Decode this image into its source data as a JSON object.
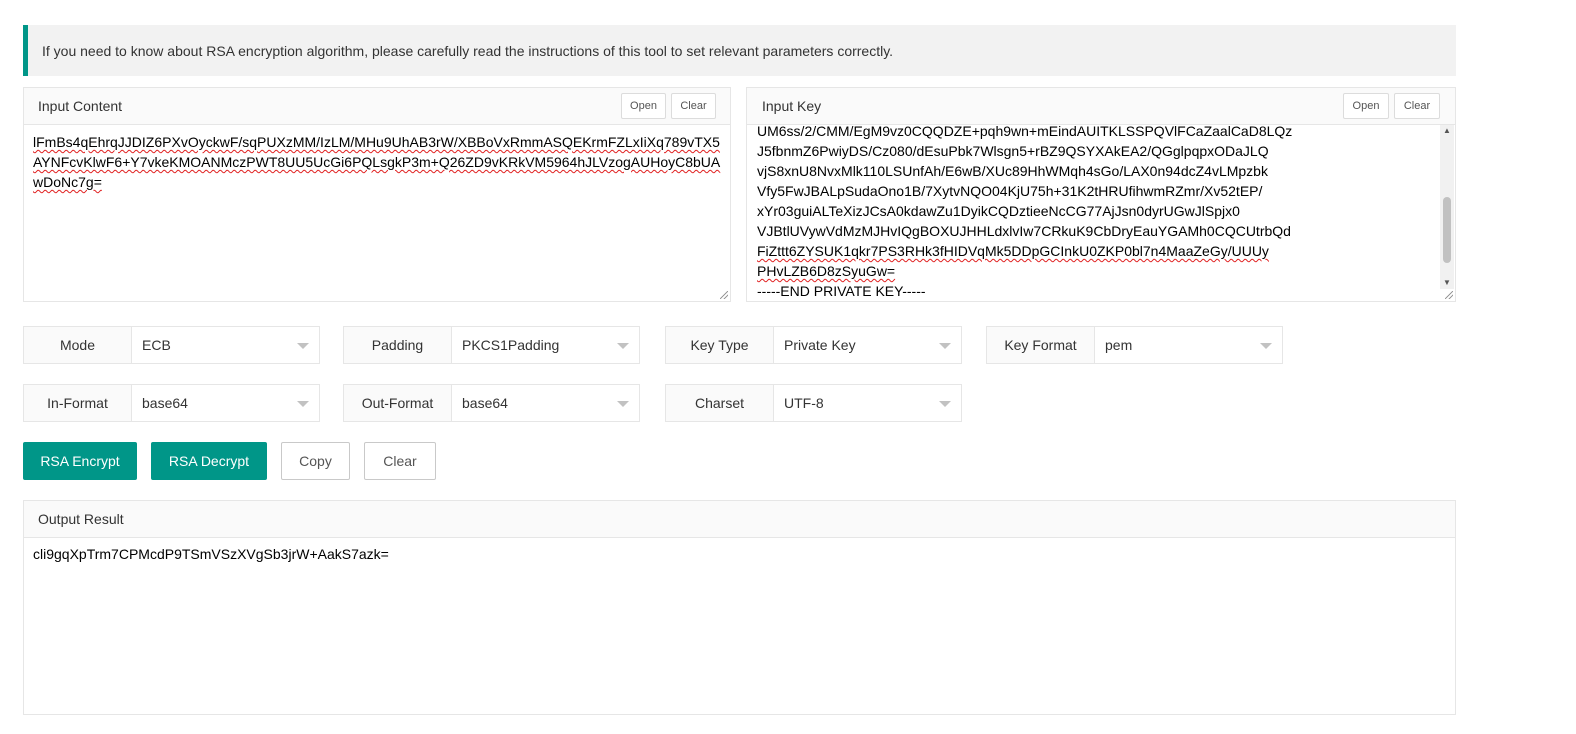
{
  "notice": {
    "text": "If you need to know about RSA encryption algorithm, please carefully read the instructions of this tool to set relevant parameters correctly."
  },
  "input_content": {
    "title": "Input Content",
    "open_label": "Open",
    "clear_label": "Clear",
    "value": "lFmBs4qEhrqJJDIZ6PXvOyckwF/sqPUXzMM/IzLM/MHu9UhAB3rW/XBBoVxRmmASQEKrmFZLxIiXq789vTX5AYNFcvKlwF6+Y7vkeKMOANMczPWT8UU5UcGi6PQLsgkP3m+Q26ZD9vKRkVM5964hJLVzogAUHoyC8bUAwDoNc7g="
  },
  "input_key": {
    "title": "Input Key",
    "open_label": "Open",
    "clear_label": "Clear",
    "lines": [
      "UM6ss/2/CMM/EgM9vz0CQQDZE+pqh9wn+mEindAUITKLSSPQVlFCaZaalCaD8LQz",
      "J5fbnmZ6PwiyDS/Cz080/dEsuPbk7Wlsgn5+rBZ9QSYXAkEA2/QGglpqpxODaJLQ",
      "vjS8xnU8NvxMlk110LSUnfAh/E6wB/XUc89HhWMqh4sGo/LAX0n94dcZ4vLMpzbk",
      "Vfy5FwJBALpSudaOno1B/7XytvNQO04KjU75h+31K2tHRUfihwmRZmr/Xv52tEP/",
      "xYr03guiALTeXizJCsA0kdawZu1DyikCQDztieeNcCG77AjJsn0dyrUGwJlSpjx0",
      "VJBtlUVywVdMzMJHvIQgBOXUJHHLdxlvIw7CRkuK9CbDryEauYGAMh0CQCUtrbQd",
      "FiZttt6ZYSUK1qkr7PS3RHk3fHIDVqMk5DDpGCInkU0ZKP0bl7n4MaaZeGy/UUUy",
      "PHvLZB6D8zSyuGw=",
      "-----END PRIVATE KEY-----"
    ]
  },
  "settings": {
    "mode": {
      "label": "Mode",
      "value": "ECB"
    },
    "padding": {
      "label": "Padding",
      "value": "PKCS1Padding"
    },
    "key_type": {
      "label": "Key Type",
      "value": "Private Key"
    },
    "key_format": {
      "label": "Key Format",
      "value": "pem"
    },
    "in_format": {
      "label": "In-Format",
      "value": "base64"
    },
    "out_format": {
      "label": "Out-Format",
      "value": "base64"
    },
    "charset": {
      "label": "Charset",
      "value": "UTF-8"
    }
  },
  "actions": {
    "encrypt_label": "RSA Encrypt",
    "decrypt_label": "RSA Decrypt",
    "copy_label": "Copy",
    "clear_label": "Clear"
  },
  "output": {
    "title": "Output Result",
    "value": "cli9gqXpTrm7CPMcdP9TSmVSzXVgSb3jrW+AakS7azk="
  },
  "colors": {
    "accent": "#009688",
    "spellcheck": "#e02020"
  }
}
